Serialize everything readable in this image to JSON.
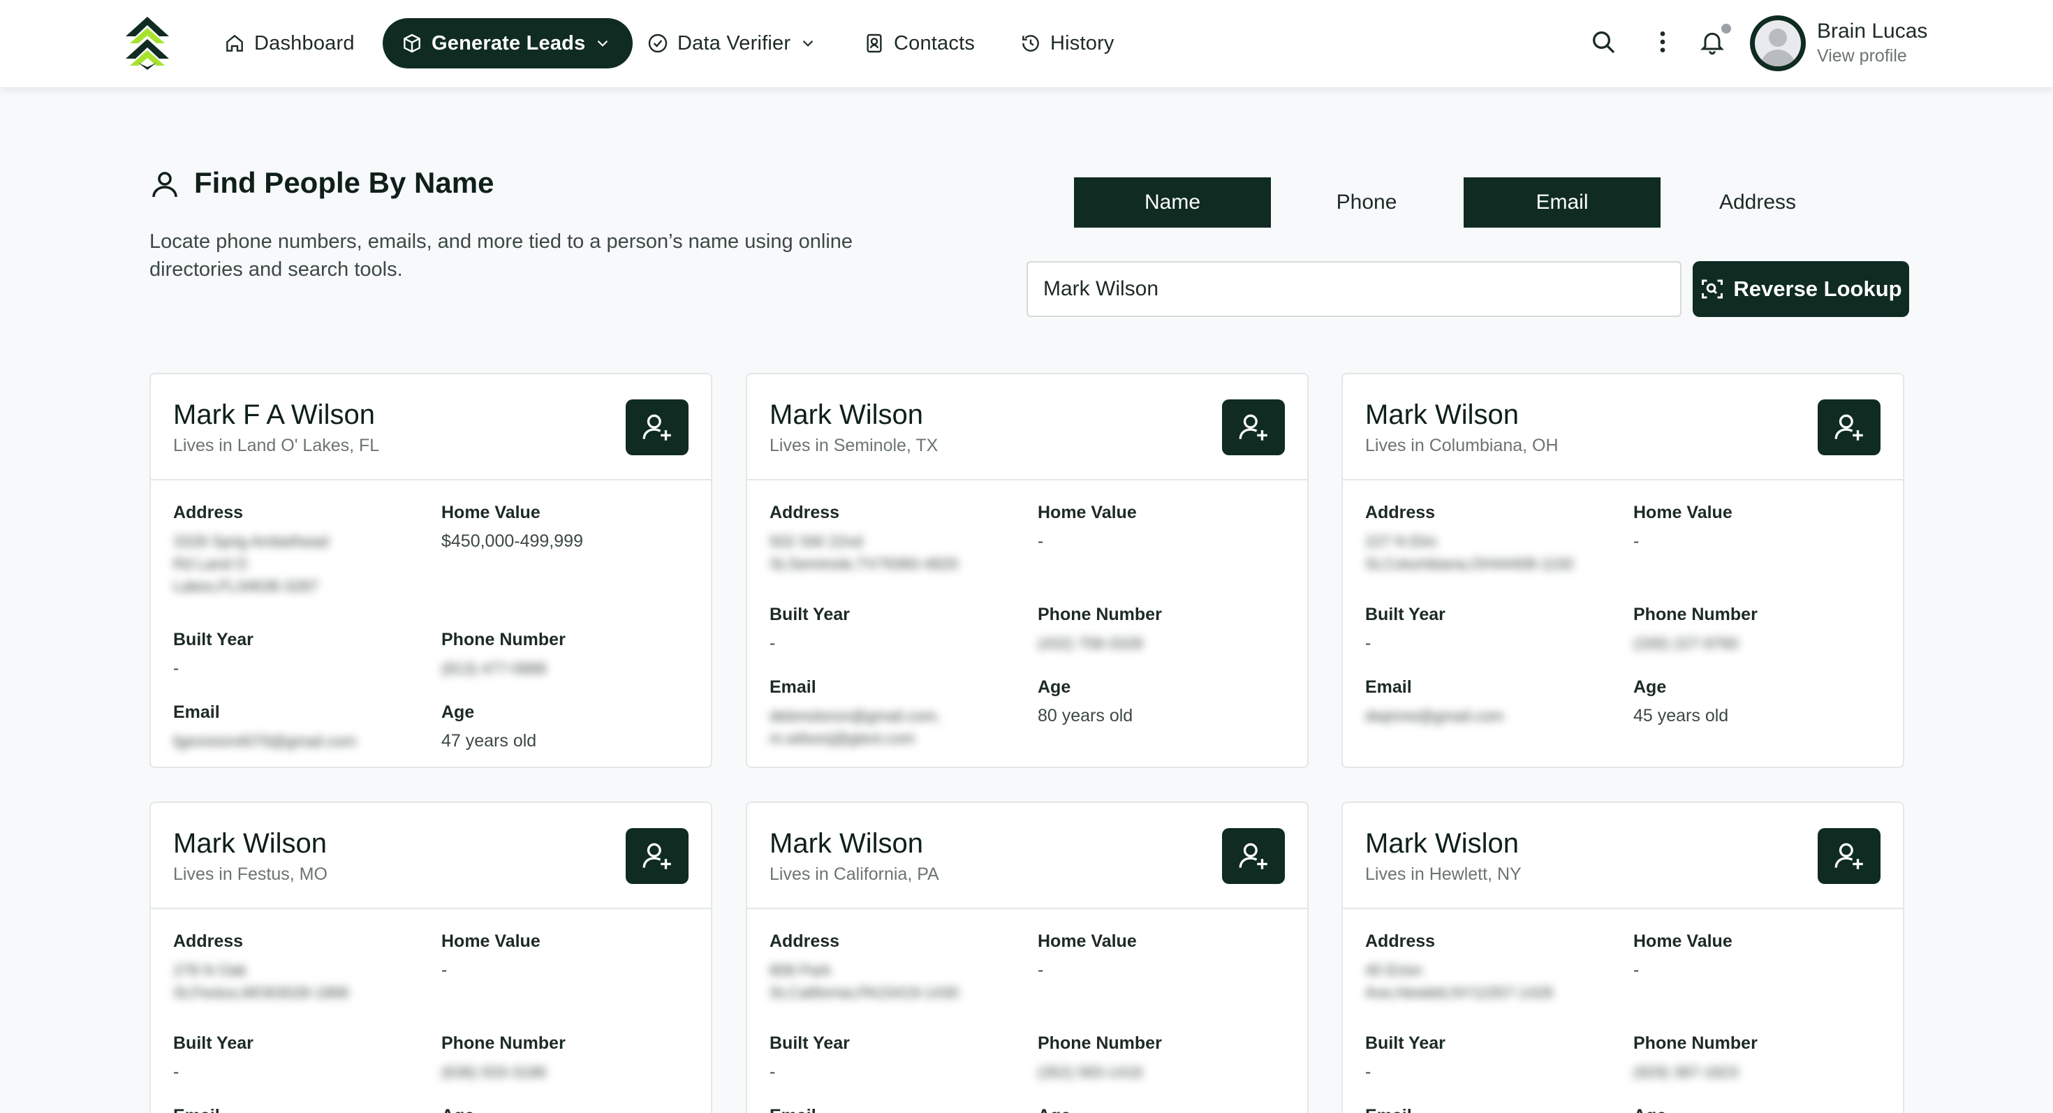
{
  "header": {
    "nav": [
      {
        "label": "Dashboard",
        "icon": "home-icon"
      },
      {
        "label": "Generate Leads",
        "icon": "leads-icon",
        "active": true
      },
      {
        "label": "Data Verifier",
        "icon": "check-circle-icon"
      },
      {
        "label": "Contacts",
        "icon": "contact-card-icon"
      },
      {
        "label": "History",
        "icon": "history-icon"
      }
    ],
    "user": {
      "name": "Brain Lucas",
      "sub": "View profile"
    }
  },
  "search": {
    "title": "Find People By Name",
    "description": "Locate phone numbers, emails, and more tied to a person’s name using online directories and search tools.",
    "tabs": [
      {
        "label": "Name",
        "active": true
      },
      {
        "label": "Phone",
        "active": false
      },
      {
        "label": "Email",
        "active": true
      },
      {
        "label": "Address",
        "active": false
      }
    ],
    "query": "Mark Wilson",
    "button_label": "Reverse Lookup"
  },
  "labels": {
    "address": "Address",
    "home_value": "Home Value",
    "built_year": "Built Year",
    "phone": "Phone Number",
    "email": "Email",
    "age": "Age"
  },
  "results": [
    {
      "name": "Mark F A Wilson",
      "location": "Lives in Land O' Lakes, FL",
      "address_lines": [
        "3328 Sprig Ambelhead",
        "Rd Land O",
        "Lakes,FL34638-3287"
      ],
      "home_value": "$450,000-499,999",
      "built_year": "-",
      "phone": "(813) 477-0888",
      "email_lines": [
        "fgenninm4079@gmail.com"
      ],
      "age": "47 years old"
    },
    {
      "name": "Mark Wilson",
      "location": "Lives in Seminole, TX",
      "address_lines": [
        "502 SW 22nd",
        "St,Seminole,TX79360-4820"
      ],
      "home_value": "-",
      "built_year": "-",
      "phone": "(432) 758-3328",
      "email_lines": [
        "debmoloron@gmail.com,",
        "m.wilsonj@gtext.com"
      ],
      "age": "80 years old"
    },
    {
      "name": "Mark Wilson",
      "location": "Lives in Columbiana, OH",
      "address_lines": [
        "227 N Elm",
        "St,Columbiana,OH44408-1192"
      ],
      "home_value": "-",
      "built_year": "-",
      "phone": "(330) 227-9760",
      "email_lines": [
        "dwjmne@gmail.com"
      ],
      "age": "45 years old"
    },
    {
      "name": "Mark Wilson",
      "location": "Lives in Festus, MO",
      "address_lines": [
        "278 N Oak",
        "St,Festus,MO63028-1866"
      ],
      "home_value": "-",
      "built_year": "-",
      "phone": "(636) 933-3186",
      "email_lines": [],
      "age": ""
    },
    {
      "name": "Mark Wilson",
      "location": "Lives in California, PA",
      "address_lines": [
        "808 Park",
        "St,California,PA15419-1430"
      ],
      "home_value": "-",
      "built_year": "-",
      "phone": "(352) 583-1416",
      "email_lines": [],
      "age": ""
    },
    {
      "name": "Mark Wislon",
      "location": "Lives in Hewlett, NY",
      "address_lines": [
        "40 Erion",
        "Ave,Hewlett,NY11557-1426"
      ],
      "home_value": "-",
      "built_year": "-",
      "phone": "(929) 387-1823",
      "email_lines": [],
      "age": ""
    }
  ],
  "colors": {
    "brand": "#0f2b22",
    "accent_logo": "#a6e22e",
    "bg": "#f7f9fb"
  }
}
